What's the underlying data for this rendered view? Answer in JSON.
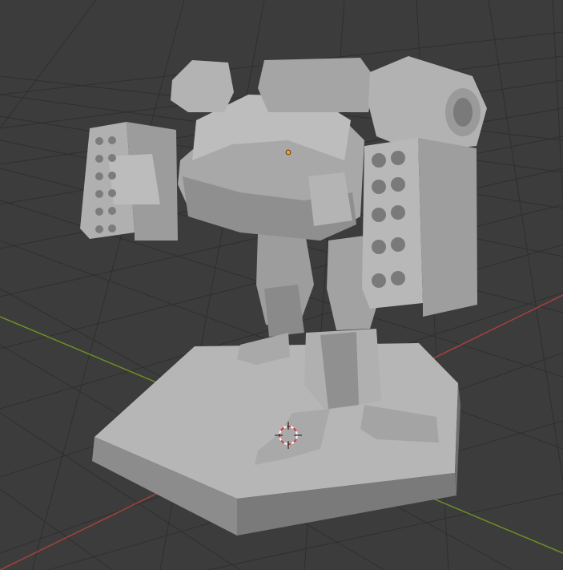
{
  "viewport": {
    "scene": {
      "object_name": "mech-model",
      "has_base": true,
      "grid": true
    },
    "colors": {
      "background": "#3c3c3c",
      "grid_line": "#2f2f2f",
      "x_axis": "#a3423d",
      "y_axis": "#6b8e23",
      "mesh_light": "#b9b9b9",
      "mesh_mid": "#9a9a9a",
      "mesh_dark": "#6f6f6f",
      "origin_dot": "#f29b2d",
      "cursor_red": "#d23c3c"
    },
    "icons": [
      "3d-cursor-icon",
      "object-origin-icon"
    ]
  }
}
